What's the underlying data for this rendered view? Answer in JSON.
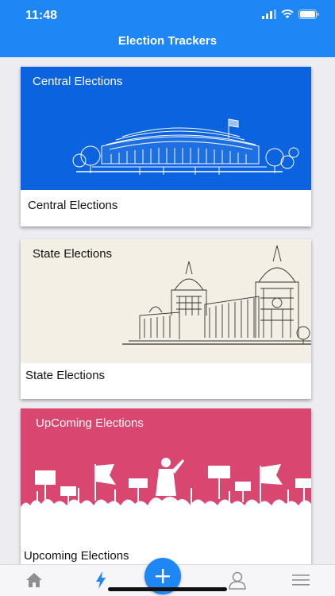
{
  "status_bar": {
    "time": "11:48"
  },
  "nav": {
    "title": "Election Trackers"
  },
  "cards": [
    {
      "banner_text": "Central Elections",
      "label": "Central Elections"
    },
    {
      "banner_text": "State Elections",
      "label": "State Elections"
    },
    {
      "banner_text": "UpComing Elections",
      "label": "Upcoming Elections"
    }
  ],
  "tabs": [
    {
      "icon": "home-icon"
    },
    {
      "icon": "bolt-icon",
      "active": true
    },
    {
      "icon": "plus-icon"
    },
    {
      "icon": "user-icon"
    },
    {
      "icon": "menu-icon"
    }
  ],
  "colors": {
    "primary": "#1e86f5",
    "central_banner": "#0b63e0",
    "state_banner": "#f3efe4",
    "upcoming_banner": "#d9466f",
    "tab_active": "#1e86f5",
    "tab_inactive": "#8e8e93"
  }
}
